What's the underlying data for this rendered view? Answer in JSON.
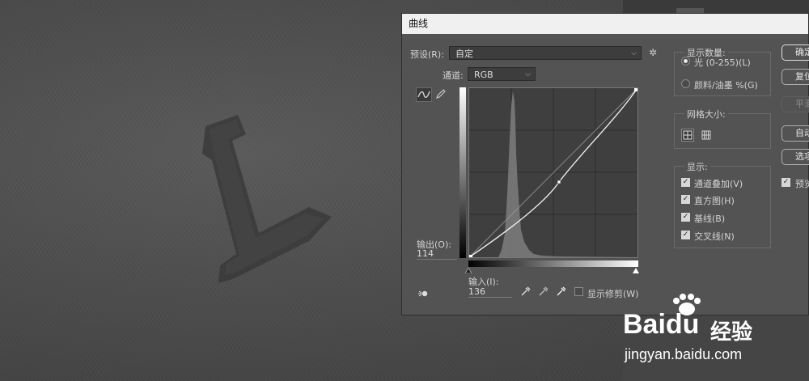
{
  "dialog": {
    "title": "曲线",
    "preset_label": "预设(R):",
    "preset_value": "自定",
    "channel_label": "通道:",
    "channel_value": "RGB",
    "output_label": "输出(O):",
    "output_value": "114",
    "input_label": "输入(I):",
    "input_value": "136",
    "show_clipping_label": "显示修剪(W)"
  },
  "display_amount": {
    "title": "显示数量:",
    "options": [
      "光 (0-255)(L)",
      "颜料/油墨 %(G)"
    ],
    "selected_index": 0
  },
  "grid_size": {
    "title": "网格大小:"
  },
  "show": {
    "title": "显示:",
    "options": [
      {
        "label": "通道叠加(V)",
        "checked": true
      },
      {
        "label": "直方图(H)",
        "checked": true
      },
      {
        "label": "基线(B)",
        "checked": true
      },
      {
        "label": "交叉线(N)",
        "checked": true
      }
    ]
  },
  "buttons": {
    "ok": "确定",
    "reset": "复位",
    "smooth": "平滑",
    "auto": "自动",
    "options": "选项",
    "preview_label": "预览",
    "preview_checked": true
  },
  "curve": {
    "control_point": {
      "input": 136,
      "output": 114
    }
  },
  "watermark": {
    "brand": "Baidu",
    "cn": "经验",
    "url": "jingyan.baidu.com"
  },
  "icons": [
    "curve-tool-icon",
    "pencil-tool-icon",
    "gear-icon",
    "eyedropper-black-icon",
    "eyedropper-gray-icon",
    "eyedropper-white-icon",
    "hand-target-icon",
    "grid-simple-icon",
    "grid-detailed-icon"
  ]
}
